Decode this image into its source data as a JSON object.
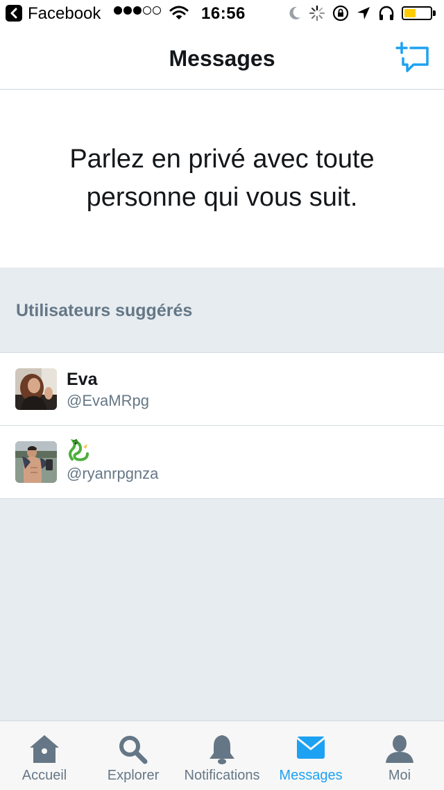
{
  "status_bar": {
    "back_app": "Facebook",
    "time": "16:56",
    "signal_bars_filled": 3,
    "signal_bars_total": 5,
    "battery_level": 0.45,
    "battery_color": "#ffcc00"
  },
  "header": {
    "title": "Messages",
    "compose_icon": "new-message-icon"
  },
  "intro": {
    "text": "Parlez en privé avec toute personne qui vous suit."
  },
  "suggested": {
    "title": "Utilisateurs suggérés",
    "users": [
      {
        "name": "Eva",
        "handle": "@EvaMRpg"
      },
      {
        "name": "",
        "name_icon": "dragon-emoji",
        "handle": "@ryanrpgnza"
      }
    ]
  },
  "tab_bar": {
    "active_index": 3,
    "active_color": "#1da1f2",
    "inactive_color": "#657786",
    "tabs": [
      {
        "label": "Accueil",
        "icon": "home-icon"
      },
      {
        "label": "Explorer",
        "icon": "search-icon"
      },
      {
        "label": "Notifications",
        "icon": "bell-icon"
      },
      {
        "label": "Messages",
        "icon": "envelope-icon"
      },
      {
        "label": "Moi",
        "icon": "profile-icon"
      }
    ]
  }
}
